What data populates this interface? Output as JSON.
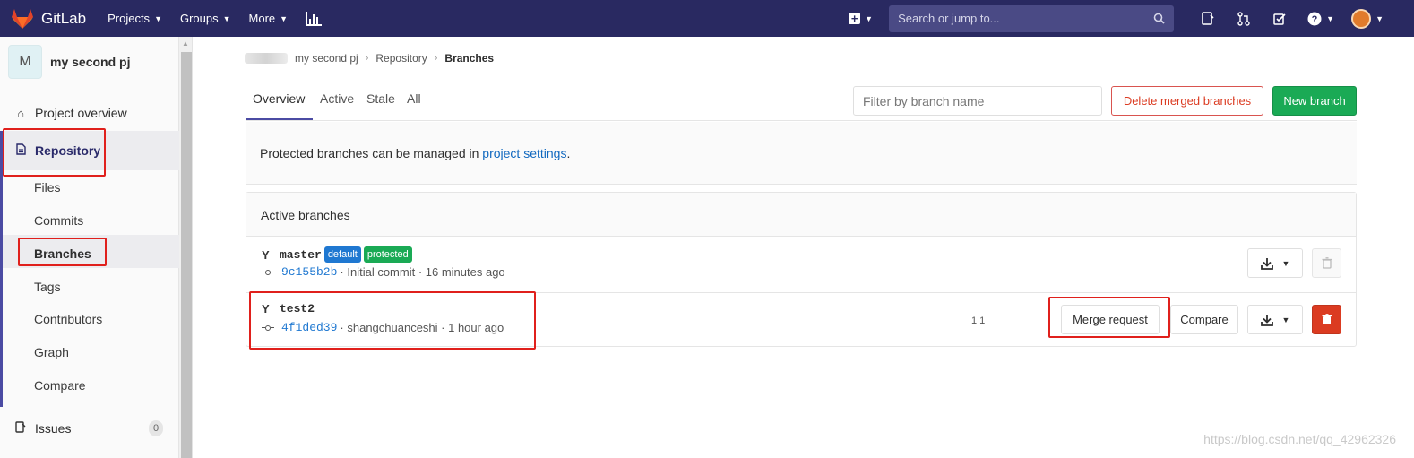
{
  "navbar": {
    "brand": "GitLab",
    "menu": [
      "Projects",
      "Groups",
      "More"
    ],
    "search_placeholder": "Search or jump to...",
    "bg_color": "#292961"
  },
  "sidebar": {
    "project_initial": "M",
    "project_name": "my second pj",
    "items": [
      {
        "label": "Project overview",
        "icon": "home-icon"
      },
      {
        "label": "Repository",
        "icon": "document-icon"
      },
      {
        "label": "Issues",
        "icon": "issues-icon",
        "count": "0"
      }
    ],
    "sub_items": [
      "Files",
      "Commits",
      "Branches",
      "Tags",
      "Contributors",
      "Graph",
      "Compare"
    ],
    "active_sub": "Branches"
  },
  "breadcrumb": [
    "my second pj",
    "Repository",
    "Branches"
  ],
  "tabs": [
    "Overview",
    "Active",
    "Stale",
    "All"
  ],
  "filter_placeholder": "Filter by branch name",
  "buttons": {
    "delete_merged": "Delete merged branches",
    "new_branch": "New branch",
    "merge_request": "Merge request",
    "compare": "Compare"
  },
  "notice": {
    "prefix": "Protected branches can be managed in ",
    "link": "project settings",
    "suffix": "."
  },
  "panel_title": "Active branches",
  "branches": [
    {
      "name": "master",
      "badges": [
        "default",
        "protected"
      ],
      "sha": "9c155b2b",
      "message": "· Initial commit · 16 minutes ago"
    },
    {
      "name": "test2",
      "sha": "4f1ded39",
      "message": "· shangchuanceshi · 1 hour ago",
      "marker": "1 1"
    }
  ],
  "watermark": "https://blog.csdn.net/qq_42962326",
  "colors": {
    "accent": "#4b4ba3",
    "link": "#1068bf",
    "success": "#1aaa55",
    "danger": "#db3b21",
    "annotation": "#e0201c"
  }
}
